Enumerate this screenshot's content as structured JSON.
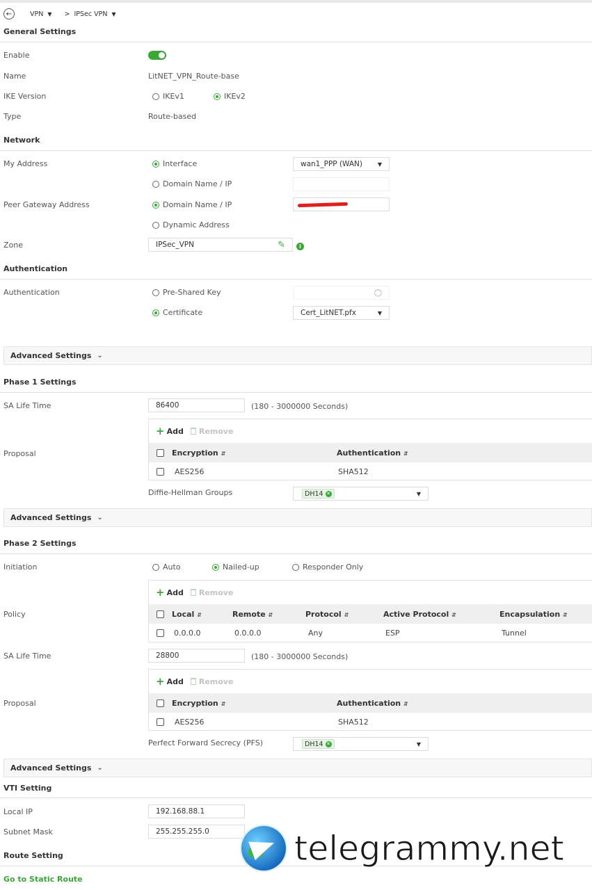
{
  "breadcrumb": {
    "item1": "VPN",
    "sep": ">",
    "item2": "IPSec VPN"
  },
  "general": {
    "heading": "General Settings",
    "enable_label": "Enable",
    "enable_on": true,
    "name_label": "Name",
    "name_value": "LitNET_VPN_Route-base",
    "ike_label": "IKE Version",
    "ike_options": [
      "IKEv1",
      "IKEv2"
    ],
    "ike_selected": "IKEv2",
    "type_label": "Type",
    "type_value": "Route-based"
  },
  "network": {
    "heading": "Network",
    "my_address_label": "My Address",
    "my_address_opt1": "Interface",
    "my_address_opt2": "Domain Name / IP",
    "interface_value": "wan1_PPP (WAN)",
    "peer_label": "Peer Gateway Address",
    "peer_opt1": "Domain Name / IP",
    "peer_opt2": "Dynamic Address",
    "zone_label": "Zone",
    "zone_value": "IPSec_VPN"
  },
  "authentication": {
    "heading": "Authentication",
    "label": "Authentication",
    "opt1": "Pre-Shared Key",
    "opt2": "Certificate",
    "certificate_value": "Cert_LitNET.pfx"
  },
  "advanced_label": "Advanced Settings",
  "phase1": {
    "heading": "Phase 1 Settings",
    "sa_label": "SA Life Time",
    "sa_value": "86400",
    "sa_hint": "(180 - 3000000 Seconds)",
    "proposal_label": "Proposal",
    "add": "Add",
    "remove": "Remove",
    "col_encryption": "Encryption",
    "col_authentication": "Authentication",
    "row_encryption": "AES256",
    "row_authentication": "SHA512",
    "dh_label": "Diffie-Hellman Groups",
    "dh_tag": "DH14"
  },
  "phase2": {
    "heading": "Phase 2 Settings",
    "initiation_label": "Initiation",
    "init_opt1": "Auto",
    "init_opt2": "Nailed-up",
    "init_opt3": "Responder Only",
    "policy_label": "Policy",
    "add": "Add",
    "remove": "Remove",
    "col_local": "Local",
    "col_remote": "Remote",
    "col_protocol": "Protocol",
    "col_active": "Active Protocol",
    "col_encap": "Encapsulation",
    "row_local": "0.0.0.0",
    "row_remote": "0.0.0.0",
    "row_protocol": "Any",
    "row_active": "ESP",
    "row_encap": "Tunnel",
    "sa_label": "SA Life Time",
    "sa_value": "28800",
    "sa_hint": "(180 - 3000000 Seconds)",
    "proposal_label": "Proposal",
    "col_encryption": "Encryption",
    "col_authentication": "Authentication",
    "row_encryption": "AES256",
    "row_authentication": "SHA512",
    "pfs_label": "Perfect Forward Secrecy (PFS)",
    "pfs_tag": "DH14"
  },
  "vti": {
    "heading": "VTI Setting",
    "local_ip_label": "Local IP",
    "local_ip_value": "192.168.88.1",
    "subnet_label": "Subnet Mask",
    "subnet_value": "255.255.255.0"
  },
  "route": {
    "heading": "Route Setting",
    "link": "Go to Static Route"
  },
  "watermark": {
    "text": "telegrammy.net"
  },
  "colors": {
    "accent": "#3aa835",
    "redaction": "#e02020"
  }
}
